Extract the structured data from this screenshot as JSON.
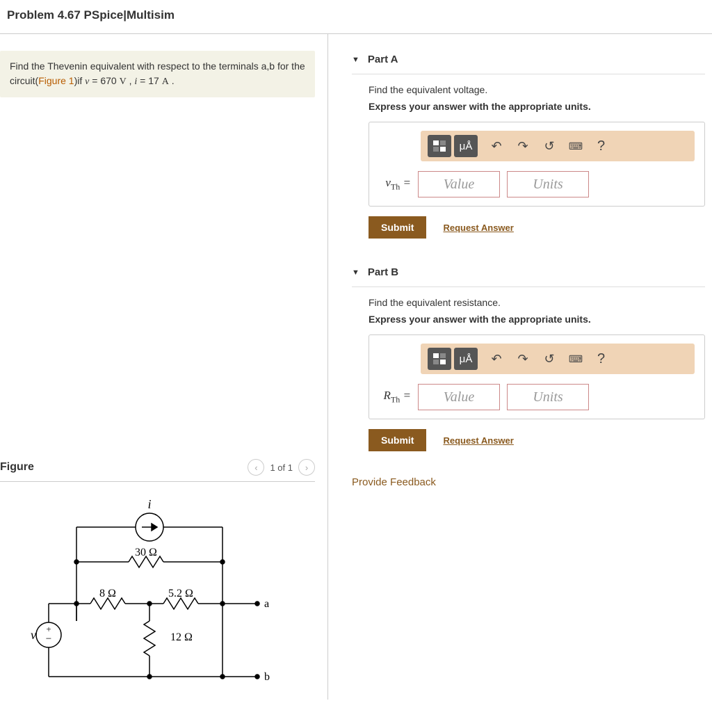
{
  "title": "Problem 4.67 PSpice|Multisim",
  "problem": {
    "text_prefix": "Find the Thevenin equivalent with respect to the terminals a,b for the circuit(",
    "figure_link": "Figure 1",
    "text_suffix_1": ")if ",
    "v_var": "v",
    "v_val": " = 670 ",
    "v_unit": "V",
    "sep": " , ",
    "i_var": "i",
    "i_val": " = 17 ",
    "i_unit": "A",
    "period": " ."
  },
  "figure": {
    "heading": "Figure",
    "pager": "1 of 1",
    "labels": {
      "i": "i",
      "r30": "30 Ω",
      "r8": "8 Ω",
      "r52": "5.2 Ω",
      "r12": "12 Ω",
      "v": "v",
      "a": "a",
      "b": "b"
    }
  },
  "parts": {
    "a": {
      "label": "Part A",
      "instr": "Find the equivalent voltage.",
      "bold": "Express your answer with the appropriate units.",
      "var_html": "v",
      "var_sub": "Th",
      "eq": " =",
      "value_ph": "Value",
      "units_ph": "Units"
    },
    "b": {
      "label": "Part B",
      "instr": "Find the equivalent resistance.",
      "bold": "Express your answer with the appropriate units.",
      "var_html": "R",
      "var_sub": "Th",
      "eq": " =",
      "value_ph": "Value",
      "units_ph": "Units"
    }
  },
  "toolbar": {
    "units_btn": "μÅ",
    "help": "?"
  },
  "actions": {
    "submit": "Submit",
    "request": "Request Answer"
  },
  "feedback": "Provide Feedback"
}
